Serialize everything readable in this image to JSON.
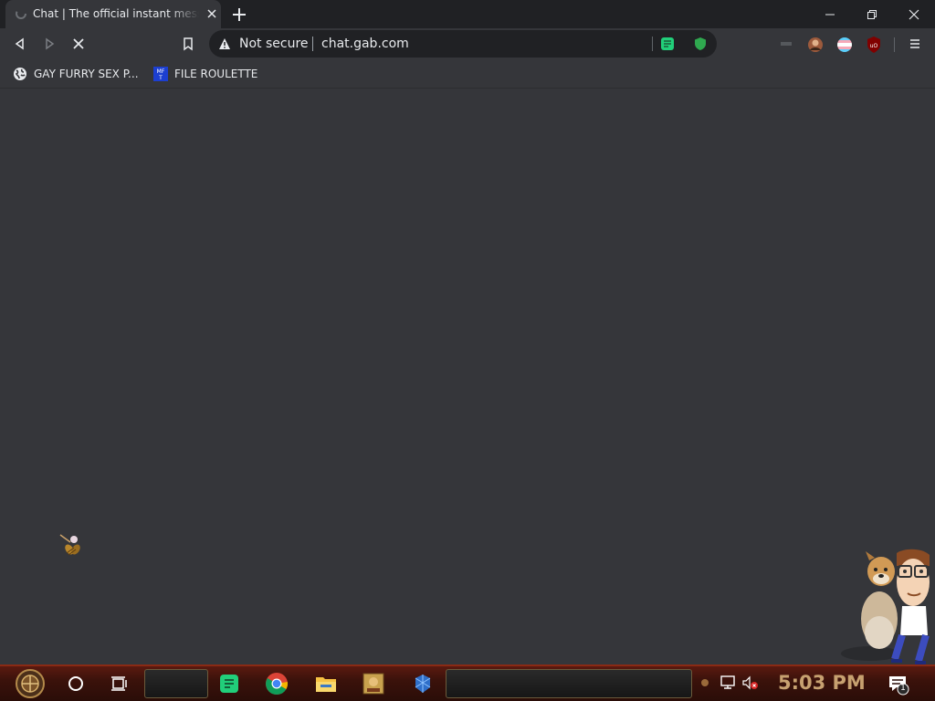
{
  "browser": {
    "tab": {
      "title": "Chat | The official instant messenger of Gab"
    },
    "omnibox": {
      "security_label": "Not secure",
      "url": "chat.gab.com"
    },
    "bookmarks": [
      {
        "label": "GAY FURRY SEX P...",
        "icon": "globe-icon"
      },
      {
        "label": "FILE ROULETTE",
        "icon": "mft-icon"
      }
    ]
  },
  "taskbar": {
    "pinned": [
      "start-icon",
      "cortana-icon",
      "task-view-icon",
      "gab-icon",
      "chrome-icon",
      "file-explorer-icon",
      "app-icon",
      "app-icon-2"
    ],
    "clock": "5:03 PM",
    "notification_count": "1"
  },
  "colors": {
    "chrome_bg": "#35363a",
    "tabstrip_bg": "#202124",
    "omnibox_bg": "#202124",
    "gab_green": "#21cf7a",
    "taskbar_accent": "#8a2a14",
    "clock": "#c7a170"
  }
}
